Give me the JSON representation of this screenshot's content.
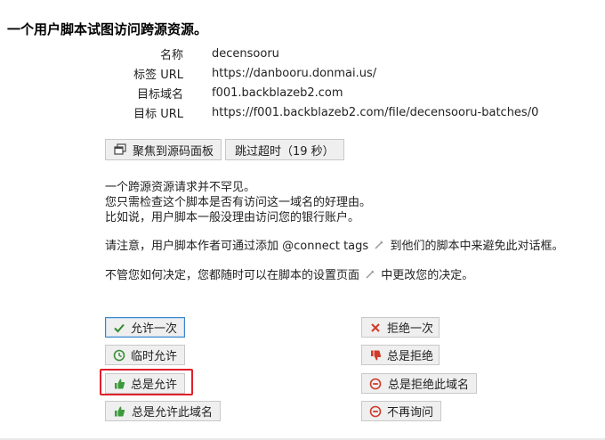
{
  "title": "一个用户脚本试图访问跨源资源。",
  "info": [
    {
      "key": "名称",
      "value": "decensooru"
    },
    {
      "key": "标签 URL",
      "value": "https://danbooru.donmai.us/"
    },
    {
      "key": "目标域名",
      "value": "f001.backblazeb2.com"
    },
    {
      "key": "目标 URL",
      "value": "https://f001.backblazeb2.com/file/decensooru-batches/0"
    }
  ],
  "actions": {
    "focus_source": "聚焦到源码面板",
    "skip_timeout": "跳过超时（19 秒）"
  },
  "explain": {
    "line1": "一个跨源资源请求并不罕见。",
    "line2": "您只需检查这个脚本是否有访问这一域名的好理由。",
    "line3": "比如说，用户脚本一般没理由访问您的银行账户。",
    "note_pre": "请注意，用户脚本作者可通过添加 @connect tags",
    "note_post": "到他们的脚本中来避免此对话框。",
    "decide_pre": "不管您如何决定，您都随时可以在脚本的设置页面",
    "decide_post": "中更改您的决定。"
  },
  "allow": {
    "once": "允许一次",
    "temp": "临时允许",
    "always": "总是允许",
    "always_domain": "总是允许此域名"
  },
  "deny": {
    "once": "拒绝一次",
    "always": "总是拒绝",
    "always_domain": "总是拒绝此域名",
    "never_ask": "不再询问"
  },
  "colors": {
    "check_green": "#2e8b2e",
    "clock_green": "#3a8f3a",
    "thumbs_green": "#3c9a3c",
    "deny_red": "#d03a2a",
    "highlight_red": "#e0202a",
    "focus_blue": "#3a86c8"
  }
}
